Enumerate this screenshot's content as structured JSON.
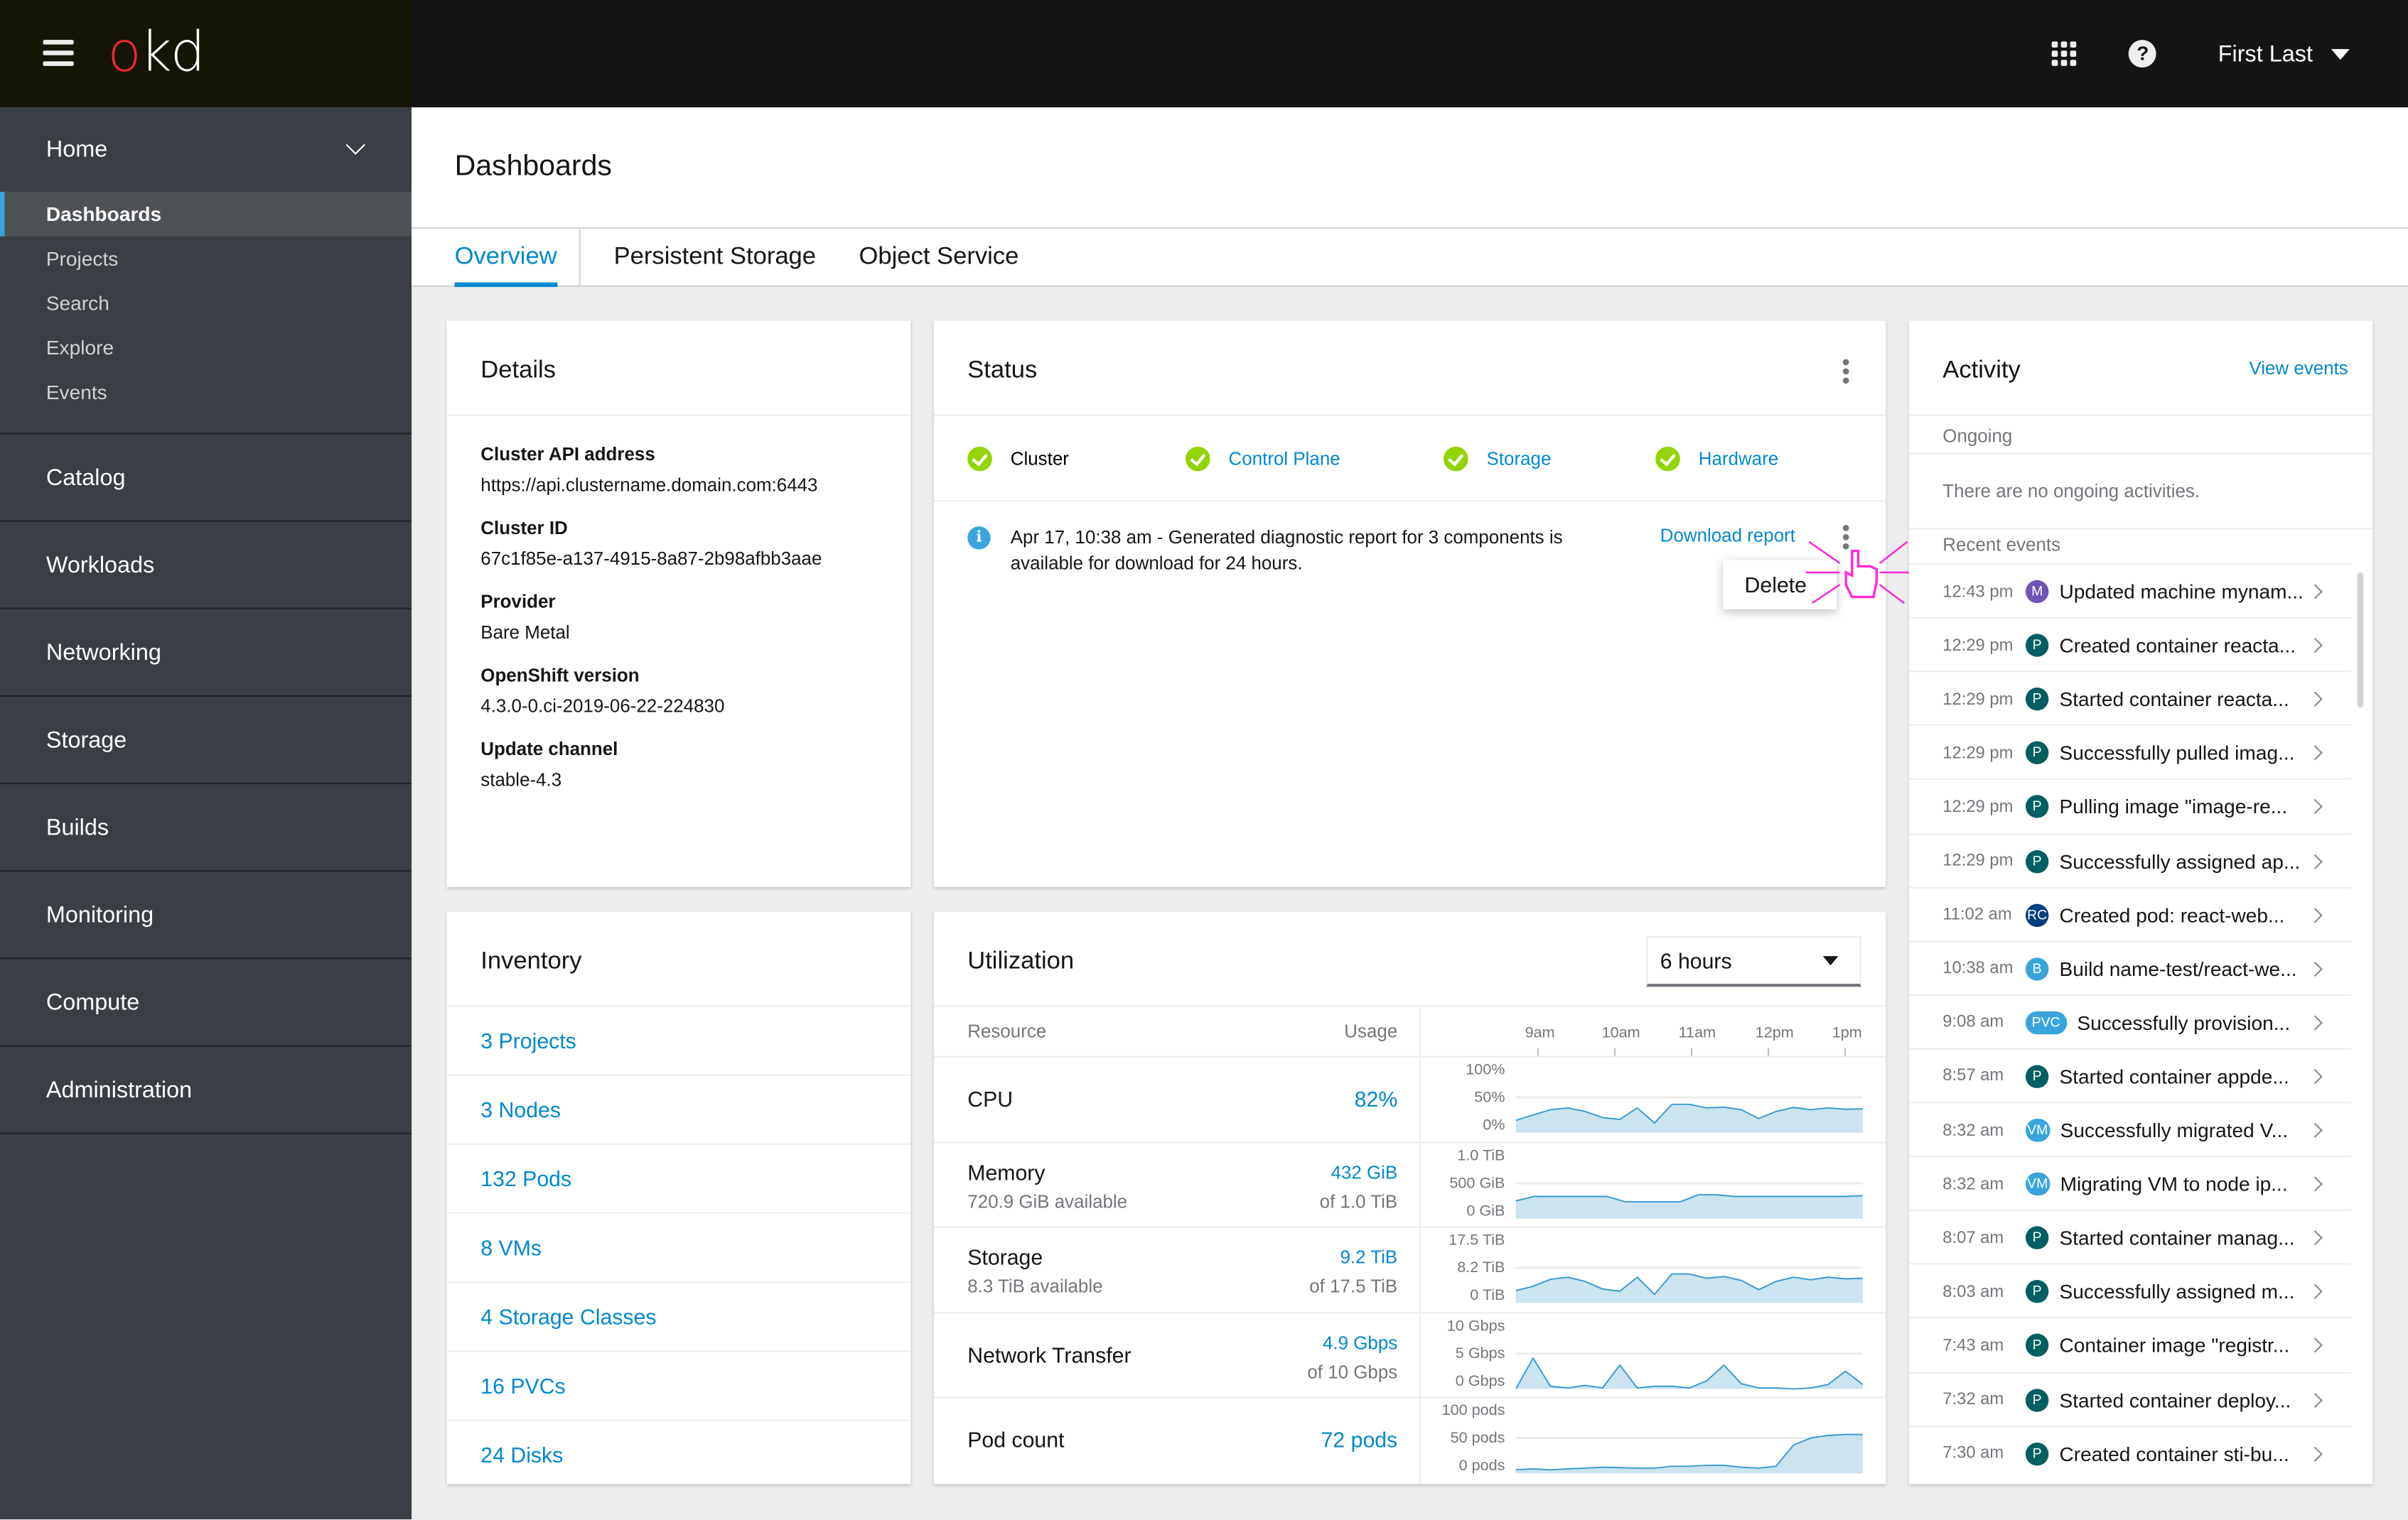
{
  "header": {
    "logo_o": "o",
    "logo_rest": "kd",
    "user_name": "First Last"
  },
  "sidebar": {
    "home": {
      "label": "Home",
      "items": [
        {
          "label": "Dashboards",
          "active": true
        },
        {
          "label": "Projects"
        },
        {
          "label": "Search"
        },
        {
          "label": "Explore"
        },
        {
          "label": "Events"
        }
      ]
    },
    "items": [
      {
        "label": "Catalog"
      },
      {
        "label": "Workloads"
      },
      {
        "label": "Networking"
      },
      {
        "label": "Storage"
      },
      {
        "label": "Builds"
      },
      {
        "label": "Monitoring"
      },
      {
        "label": "Compute"
      },
      {
        "label": "Administration"
      }
    ]
  },
  "page": {
    "title": "Dashboards",
    "tabs": [
      {
        "label": "Overview",
        "active": true
      },
      {
        "label": "Persistent Storage"
      },
      {
        "label": "Object Service"
      }
    ]
  },
  "details": {
    "title": "Details",
    "fields": [
      {
        "label": "Cluster API address",
        "value": "https://api.clustername.domain.com:6443"
      },
      {
        "label": "Cluster ID",
        "value": "67c1f85e-a137-4915-8a87-2b98afbb3aae"
      },
      {
        "label": "Provider",
        "value": "Bare Metal"
      },
      {
        "label": "OpenShift version",
        "value": "4.3.0-0.ci-2019-06-22-224830"
      },
      {
        "label": "Update channel",
        "value": "stable-4.3"
      }
    ]
  },
  "status": {
    "title": "Status",
    "items": [
      {
        "label": "Cluster",
        "state": "ok",
        "link": false
      },
      {
        "label": "Control Plane",
        "state": "ok",
        "link": true
      },
      {
        "label": "Storage",
        "state": "ok",
        "link": true
      },
      {
        "label": "Hardware",
        "state": "ok",
        "link": true
      }
    ],
    "alert": {
      "text": "Apr 17, 10:38 am - Generated diagnostic report for 3 components is available for download for 24 hours.",
      "action": "Download report",
      "menu_item": "Delete"
    }
  },
  "activity": {
    "title": "Activity",
    "view_events": "View events",
    "ongoing_label": "Ongoing",
    "ongoing_empty": "There are no ongoing activities.",
    "recent_label": "Recent events",
    "events": [
      {
        "time": "12:43 pm",
        "badge": "M",
        "badge_color": "#6e54b5",
        "text": "Updated machine mynam..."
      },
      {
        "time": "12:29 pm",
        "badge": "P",
        "badge_color": "#005f60",
        "text": "Created container reacta..."
      },
      {
        "time": "12:29 pm",
        "badge": "P",
        "badge_color": "#005f60",
        "text": "Started container reacta..."
      },
      {
        "time": "12:29 pm",
        "badge": "P",
        "badge_color": "#005f60",
        "text": "Successfully pulled imag..."
      },
      {
        "time": "12:29 pm",
        "badge": "P",
        "badge_color": "#005f60",
        "text": "Pulling image \"image-re..."
      },
      {
        "time": "12:29 pm",
        "badge": "P",
        "badge_color": "#005f60",
        "text": "Successfully assigned ap..."
      },
      {
        "time": "11:02 am",
        "badge": "RC",
        "badge_color": "#004080",
        "text": "Created pod: react-web..."
      },
      {
        "time": "10:38 am",
        "badge": "B",
        "badge_color": "#39a5dc",
        "text": "Build name-test/react-we..."
      },
      {
        "time": "9:08 am",
        "badge": "PVC",
        "badge_color": "#39a5dc",
        "text": "Successfully provision..."
      },
      {
        "time": "8:57 am",
        "badge": "P",
        "badge_color": "#005f60",
        "text": "Started container appde..."
      },
      {
        "time": "8:32 am",
        "badge": "VM",
        "badge_color": "#39a5dc",
        "text": "Successfully migrated V..."
      },
      {
        "time": "8:32 am",
        "badge": "VM",
        "badge_color": "#39a5dc",
        "text": "Migrating VM to node ip..."
      },
      {
        "time": "8:07 am",
        "badge": "P",
        "badge_color": "#005f60",
        "text": "Started container manag..."
      },
      {
        "time": "8:03 am",
        "badge": "P",
        "badge_color": "#005f60",
        "text": "Successfully assigned m..."
      },
      {
        "time": "7:43 am",
        "badge": "P",
        "badge_color": "#005f60",
        "text": "Container image \"registr..."
      },
      {
        "time": "7:32 am",
        "badge": "P",
        "badge_color": "#005f60",
        "text": "Started container deploy..."
      },
      {
        "time": "7:30 am",
        "badge": "P",
        "badge_color": "#005f60",
        "text": "Created container sti-bu..."
      }
    ]
  },
  "inventory": {
    "title": "Inventory",
    "items": [
      "3 Projects",
      "3 Nodes",
      "132 Pods",
      "8 VMs",
      "4 Storage Classes",
      "16 PVCs",
      "24 Disks"
    ]
  },
  "utilization": {
    "title": "Utilization",
    "range": "6 hours",
    "col_resource": "Resource",
    "col_usage": "Usage",
    "x_ticks": [
      "9am",
      "10am",
      "11am",
      "12pm",
      "1pm"
    ],
    "rows": [
      {
        "name": "CPU",
        "sub": "",
        "value": "82%",
        "of": ""
      },
      {
        "name": "Memory",
        "sub": "720.9 GiB available",
        "value": "432 GiB",
        "of": "of 1.0 TiB"
      },
      {
        "name": "Storage",
        "sub": "8.3 TiB available",
        "value": "9.2 TiB",
        "of": "of 17.5 TiB"
      },
      {
        "name": "Network Transfer",
        "sub": "",
        "value": "4.9 Gbps",
        "of": "of 10 Gbps"
      },
      {
        "name": "Pod count",
        "sub": "",
        "value": "72 pods",
        "of": ""
      }
    ]
  },
  "chart_data": [
    {
      "type": "area",
      "title": "CPU",
      "y_ticks": [
        "100%",
        "50%",
        "0%"
      ],
      "ylim": [
        0,
        100
      ],
      "x_ticks": [
        "9am",
        "10am",
        "11am",
        "12pm",
        "1pm"
      ],
      "values": [
        28,
        40,
        52,
        56,
        48,
        34,
        30,
        56,
        22,
        64,
        64,
        56,
        58,
        52,
        32,
        48,
        57,
        52,
        56,
        53,
        54
      ]
    },
    {
      "type": "area",
      "title": "Memory",
      "y_ticks": [
        "1.0 TiB",
        "500 GiB",
        "0 GiB"
      ],
      "ylim": [
        0,
        1000
      ],
      "x_ticks": [
        "9am",
        "10am",
        "11am",
        "12pm",
        "1pm"
      ],
      "values": [
        400,
        500,
        500,
        500,
        500,
        500,
        380,
        380,
        380,
        380,
        540,
        540,
        500,
        500,
        500,
        500,
        500,
        500,
        500,
        520
      ]
    },
    {
      "type": "area",
      "title": "Storage",
      "y_ticks": [
        "17.5 TiB",
        "8.2 TiB",
        "0 TiB"
      ],
      "ylim": [
        0,
        16.4
      ],
      "x_ticks": [
        "9am",
        "10am",
        "11am",
        "12pm",
        "1pm"
      ],
      "values": [
        4.6,
        6.2,
        8.8,
        9.6,
        8.0,
        5.2,
        4.4,
        9.6,
        3.2,
        10.8,
        10.8,
        9.2,
        9.8,
        8.4,
        5.0,
        8.0,
        9.6,
        8.6,
        9.6,
        9.0,
        9.2
      ]
    },
    {
      "type": "area",
      "title": "Network Transfer",
      "y_ticks": [
        "10 Gbps",
        "5 Gbps",
        "0 Gbps"
      ],
      "ylim": [
        0,
        10
      ],
      "x_ticks": [
        "9am",
        "10am",
        "11am",
        "12pm",
        "1pm"
      ],
      "values": [
        0,
        7.0,
        0.6,
        0.2,
        0.8,
        0.2,
        5.4,
        0.2,
        0.6,
        0.6,
        0.2,
        1.8,
        5.4,
        1.2,
        0.2,
        0.2,
        0,
        0.2,
        1.0,
        4.0,
        1.0
      ]
    },
    {
      "type": "area",
      "title": "Pod count",
      "y_ticks": [
        "100 pods",
        "50 pods",
        "0 pods"
      ],
      "ylim": [
        0,
        100
      ],
      "x_ticks": [
        "9am",
        "10am",
        "11am",
        "12pm",
        "1pm"
      ],
      "values": [
        8,
        10,
        8,
        10,
        12,
        14,
        13,
        12,
        12,
        16,
        16,
        18,
        18,
        14,
        12,
        16,
        64,
        80,
        86,
        88,
        88
      ]
    }
  ]
}
